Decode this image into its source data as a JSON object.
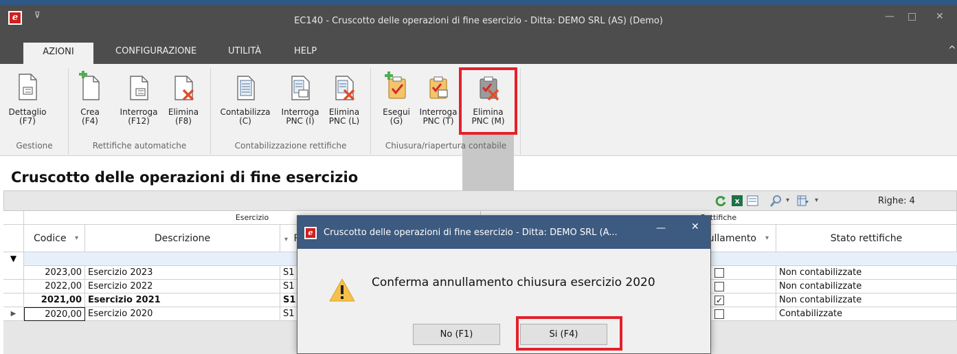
{
  "window": {
    "title": "EC140 - Cruscotto delle operazioni di fine esercizio - Ditta: DEMO SRL (AS)  (Demo)",
    "logo_text": "e",
    "min": "—",
    "max": "□",
    "close": "✕",
    "quick_access": "⊽"
  },
  "tabs": {
    "azioni": "AZIONI",
    "configurazione": "CONFIGURAZIONE",
    "utilita": "UTILITÀ",
    "help": "HELP",
    "collapse": "^"
  },
  "ribbon": {
    "gestione": {
      "group_label": "Gestione",
      "dettaglio": [
        "Dettaglio",
        "(F7)"
      ]
    },
    "rettifiche_automatiche": {
      "group_label": "Rettifiche automatiche",
      "crea": [
        "Crea",
        "(F4)"
      ],
      "interroga": [
        "Interroga",
        "(F12)"
      ],
      "elimina": [
        "Elimina",
        "(F8)"
      ]
    },
    "contabilizzazione_rettifiche": {
      "group_label": "Contabilizzazione rettifiche",
      "contabilizza": [
        "Contabilizza",
        "(C)"
      ],
      "interroga_pnc": [
        "Interroga",
        "PNC (I)"
      ],
      "elimina_pnc": [
        "Elimina",
        "PNC (L)"
      ]
    },
    "chiusura": {
      "group_label": "Chiusura/riapertura contabile",
      "esegui": [
        "Esegui",
        "(G)"
      ],
      "interroga_pnc": [
        "Interroga",
        "PNC (T)"
      ],
      "elimina_pnc": [
        "Elimina",
        "PNC (M)"
      ]
    }
  },
  "page_title": "Cruscotto delle operazioni di fine esercizio",
  "grid_toolbar": {
    "rows_label": "Righe: 4"
  },
  "grid": {
    "group_headers": {
      "esercizio": "Esercizio",
      "rettifiche": "Rettifiche"
    },
    "columns": {
      "codice": "Codice",
      "descrizione": "Descrizione",
      "po": "Po",
      "annullamento": "Annullamento",
      "stato_rettifiche": "Stato rettifiche"
    },
    "rows": [
      {
        "codice": "2023,00",
        "descrizione": "Esercizio 2023",
        "po": "S1",
        "checked": false,
        "stato": "Non contabilizzate"
      },
      {
        "codice": "2022,00",
        "descrizione": "Esercizio 2022",
        "po": "S1",
        "checked": false,
        "stato": "Non contabilizzate"
      },
      {
        "codice": "2021,00",
        "descrizione": "Esercizio 2021",
        "po": "S1",
        "checked": true,
        "stato": "Non contabilizzate"
      },
      {
        "codice": "2020,00",
        "descrizione": "Esercizio 2020",
        "po": "S1",
        "checked": false,
        "stato": "Contabilizzate"
      }
    ]
  },
  "dialog": {
    "title": "Cruscotto delle operazioni di fine esercizio - Ditta: DEMO SRL (A...",
    "logo_text": "e",
    "min": "—",
    "close": "✕",
    "message": "Conferma annullamento chiusura esercizio 2020",
    "btn_no": "No (F1)",
    "btn_si": "Si (F4)"
  },
  "colors": {
    "highlight": "#e4202a",
    "title_bar": "#4d4d4d",
    "dialog_header": "#3d5a80",
    "accent_green": "#4caf50"
  }
}
